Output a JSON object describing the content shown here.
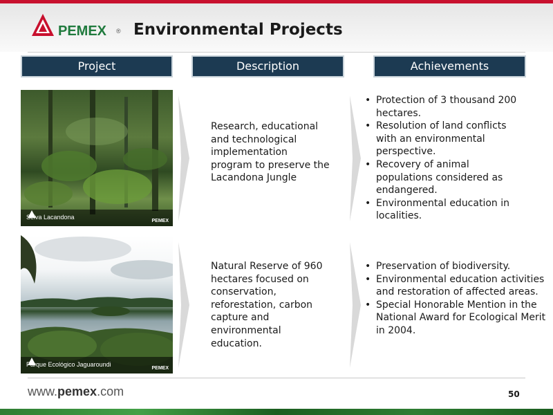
{
  "header": {
    "logo_text": "PEMEX",
    "logo_reg": "®",
    "title": "Environmental Projects"
  },
  "columns": {
    "project": "Project",
    "description": "Description",
    "achievements": "Achievements"
  },
  "rows": [
    {
      "photo_caption": "Selva Lacandona",
      "photo_logo": "PEMEX",
      "description": "Research, educational and technological implementation program to preserve the Lacandona Jungle",
      "achievements": [
        "Protection of 3 thousand 200 hectares.",
        "Resolution of land conflicts with an environmental perspective.",
        "Recovery of animal populations considered as endangered.",
        "Environmental education in localities."
      ]
    },
    {
      "photo_caption": "Parque Ecológico Jaguaroundi",
      "photo_logo": "PEMEX",
      "description": "Natural Reserve of 960 hectares focused on conservation, reforestation, carbon capture and environmental education.",
      "achievements": [
        "Preservation of biodiversity.",
        "Environmental education activities and restoration of affected areas.",
        "Special Honorable Mention in the National Award for Ecological Merit in 2004."
      ]
    }
  ],
  "footer": {
    "url_prefix": "www.",
    "url_brand": "pemex",
    "url_suffix": ".com",
    "page_number": "50"
  },
  "colors": {
    "header_fill": "#1c3a52",
    "brand_red": "#c8102e",
    "brand_green": "#1f7a3d"
  }
}
